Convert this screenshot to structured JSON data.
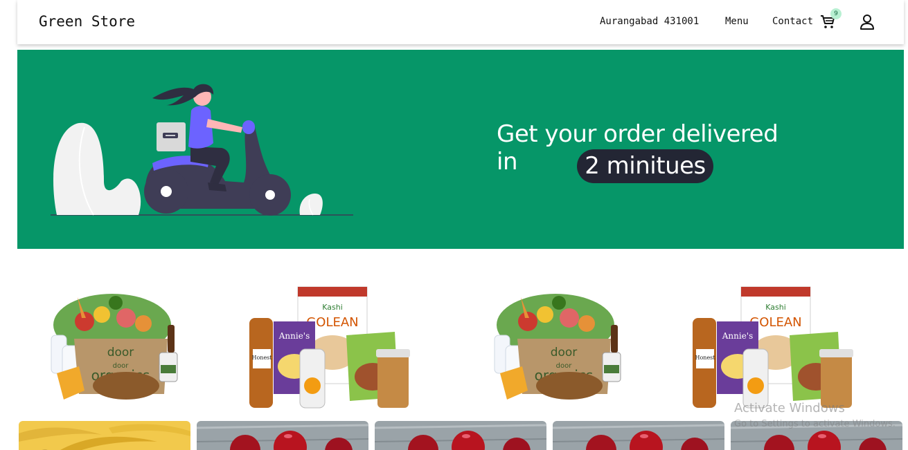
{
  "navbar": {
    "brand": "Green Store",
    "location": "Aurangabad 431001",
    "menu_label": "Menu",
    "contact_label": "Contact",
    "cart_count": "9",
    "cart_icon": "cart-icon",
    "user_icon": "user-icon"
  },
  "hero": {
    "line1": "Get your order delivered in",
    "highlight": "2 minitues",
    "bg_color": "#069668",
    "pill_color": "#232634"
  },
  "promos": [
    {
      "name": "grocery-box-banner",
      "box_text_top": "door",
      "box_text_mid": "door",
      "box_text_bottom": "organics"
    },
    {
      "name": "packaged-food-banner",
      "brand1": "Kashi",
      "brand2": "GOLEAN",
      "brand3": "Annie's",
      "brand4": "Honest"
    },
    {
      "name": "grocery-box-banner",
      "box_text_top": "door",
      "box_text_mid": "door",
      "box_text_bottom": "organics"
    },
    {
      "name": "packaged-food-banner",
      "brand1": "Kashi",
      "brand2": "GOLEAN",
      "brand3": "Annie's",
      "brand4": "Honest"
    }
  ],
  "products": [
    {
      "name": "bananas"
    },
    {
      "name": "apples"
    },
    {
      "name": "apples"
    },
    {
      "name": "apples"
    },
    {
      "name": "apples"
    }
  ],
  "watermark": {
    "title": "Activate Windows",
    "subtitle": "Go to Settings to activate Windows."
  }
}
